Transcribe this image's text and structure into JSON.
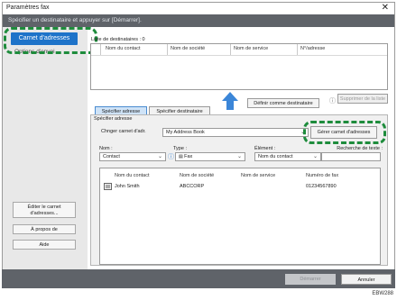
{
  "window": {
    "title": "Paramètres fax",
    "close_glyph": "✕"
  },
  "instruction": "Spécifier un destinataire et appuyer sur [Démarrer].",
  "sidebar": {
    "address_book_label": "Carnet d'adresses",
    "send_options_label": "Options d'envoi",
    "edit_address_book_label_1": "Éditer le carnet",
    "edit_address_book_label_2": "d'adresses...",
    "about_label": "À propos de",
    "help_label": "Aide"
  },
  "recipients": {
    "label": "Liste de destinataires : 0",
    "columns": [
      "Nom du contact",
      "Nom de société",
      "Nom de service",
      "N°/adresse"
    ]
  },
  "actions": {
    "define_recipient": "Définir comme destinataire",
    "delete_list": "Supprimer de la liste",
    "info_glyph": "ⓘ"
  },
  "tabs": {
    "address": "Spécifier adresse",
    "recipient": "Spécifier destinataire"
  },
  "address": {
    "section_label": "Spécifier adresse",
    "change_book_label": "Chnger carnet d'adr.",
    "book_value": "My Address Book",
    "manage_button": "Gérer carnet d'adresses",
    "name_label": "Nom :",
    "name_value": "Contact",
    "type_label": "Type :",
    "type_value": "Fax",
    "element_label": "Élément :",
    "element_value": "Nom du contact",
    "search_label": "Recherche de texte :",
    "search_value": ""
  },
  "table": {
    "columns": [
      "Nom du contact",
      "Nom de société",
      "Nom de service",
      "Numéro de fax"
    ],
    "rows": [
      {
        "contact": "John Smith",
        "company": "ABCCORP",
        "service": "",
        "fax": "01234567890"
      }
    ]
  },
  "footer": {
    "start": "Démarrer",
    "cancel": "Annuler"
  },
  "caption": "EBW288",
  "colors": {
    "accent": "#1e73c9",
    "arrow": "#3b86d8",
    "highlight": "#1e8c3c"
  }
}
